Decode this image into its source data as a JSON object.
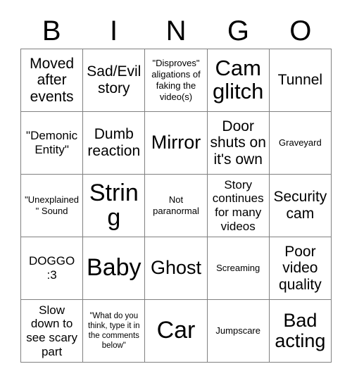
{
  "card": {
    "title": "BINGO",
    "header_letters": [
      "B",
      "I",
      "N",
      "G",
      "O"
    ],
    "grid_size": "5x5",
    "text_color": "#000000",
    "border_color": "#808080",
    "background_color": "#ffffff"
  },
  "cells": [
    {
      "text": "Moved after events",
      "size": "fs-md"
    },
    {
      "text": "Sad/Evil story",
      "size": "fs-md"
    },
    {
      "text": "\"Disproves\" aligations of faking the video(s)",
      "size": "fs-xs"
    },
    {
      "text": "Cam glitch",
      "size": "fs-xl"
    },
    {
      "text": "Tunnel",
      "size": "fs-md"
    },
    {
      "text": "\"Demonic Entity\"",
      "size": "fs-sm"
    },
    {
      "text": "Dumb reaction",
      "size": "fs-md"
    },
    {
      "text": "Mirror",
      "size": "fs-lg"
    },
    {
      "text": "Door shuts on it's own",
      "size": "fs-md"
    },
    {
      "text": "Graveyard",
      "size": "fs-xs"
    },
    {
      "text": "\"Unexplained\" Sound",
      "size": "fs-xs"
    },
    {
      "text": "String",
      "size": "fs-xxl"
    },
    {
      "text": "Not paranormal",
      "size": "fs-xs"
    },
    {
      "text": "Story continues for many videos",
      "size": "fs-sm"
    },
    {
      "text": "Security cam",
      "size": "fs-md"
    },
    {
      "text": "DOGGO :3",
      "size": "fs-sm"
    },
    {
      "text": "Baby",
      "size": "fs-xxl"
    },
    {
      "text": "Ghost",
      "size": "fs-lg"
    },
    {
      "text": "Screaming",
      "size": "fs-xs"
    },
    {
      "text": "Poor video quality",
      "size": "fs-md"
    },
    {
      "text": "Slow down to see scary part",
      "size": "fs-sm"
    },
    {
      "text": "\"What do you think, type it in the comments below\"",
      "size": "fs-xxs"
    },
    {
      "text": "Car",
      "size": "fs-xxl"
    },
    {
      "text": "Jumpscare",
      "size": "fs-xs"
    },
    {
      "text": "Bad acting",
      "size": "fs-lg"
    }
  ]
}
